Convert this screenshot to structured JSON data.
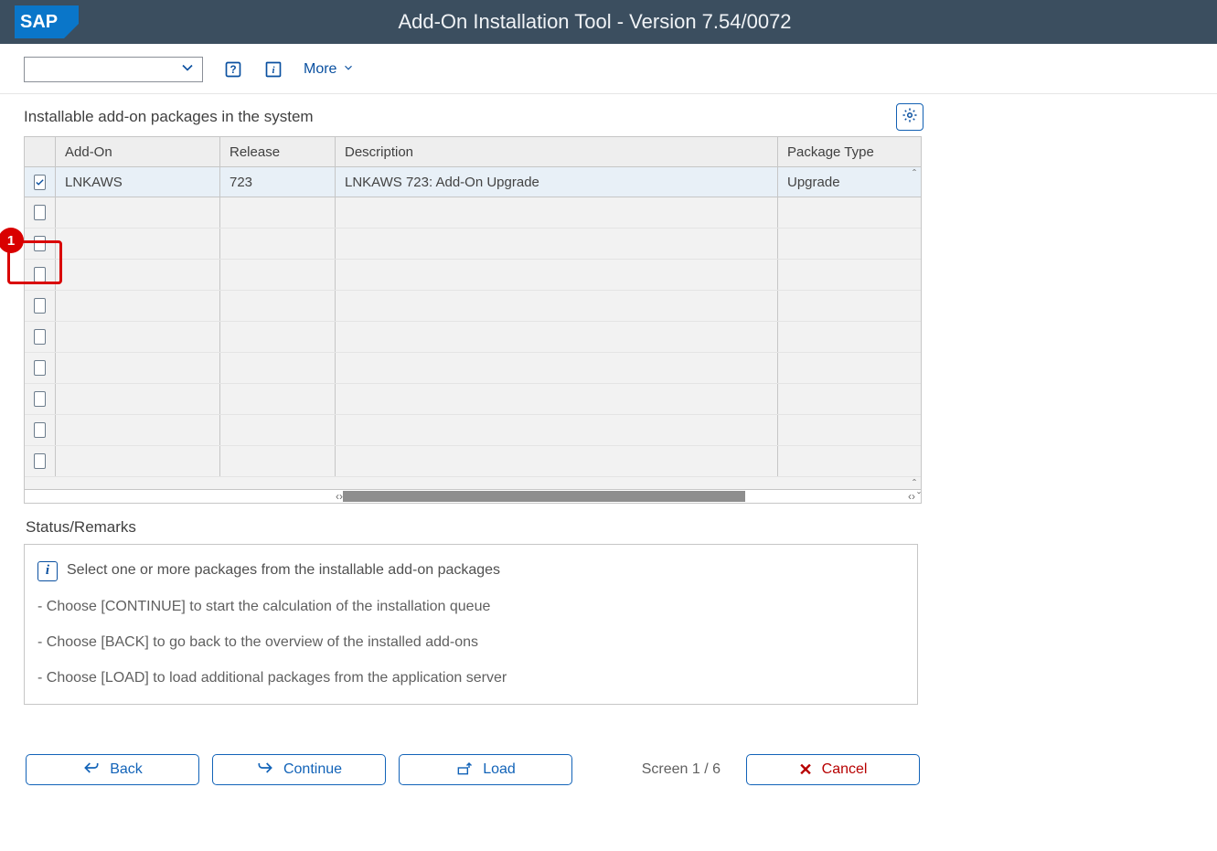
{
  "header": {
    "title": "Add-On Installation Tool - Version 7.54/0072"
  },
  "toolbar": {
    "more_label": "More"
  },
  "section": {
    "title": "Installable add-on packages in the system"
  },
  "table": {
    "columns": {
      "addon": "Add-On",
      "release": "Release",
      "description": "Description",
      "type": "Package Type"
    },
    "rows": [
      {
        "checked": true,
        "addon": "LNKAWS",
        "release": "723",
        "description": "LNKAWS 723: Add-On Upgrade",
        "type": "Upgrade"
      }
    ]
  },
  "status": {
    "title": "Status/Remarks",
    "info": "Select one or more packages from the installable add-on packages",
    "continue": "- Choose [CONTINUE] to start the calculation of the installation queue",
    "back": "- Choose [BACK] to go back to the overview of the installed add-ons",
    "load": "- Choose [LOAD] to load additional packages from the application server"
  },
  "footer": {
    "back": "Back",
    "continue": "Continue",
    "load": "Load",
    "cancel": "Cancel",
    "screen": "Screen 1 / 6"
  },
  "callout": {
    "number": "1"
  }
}
